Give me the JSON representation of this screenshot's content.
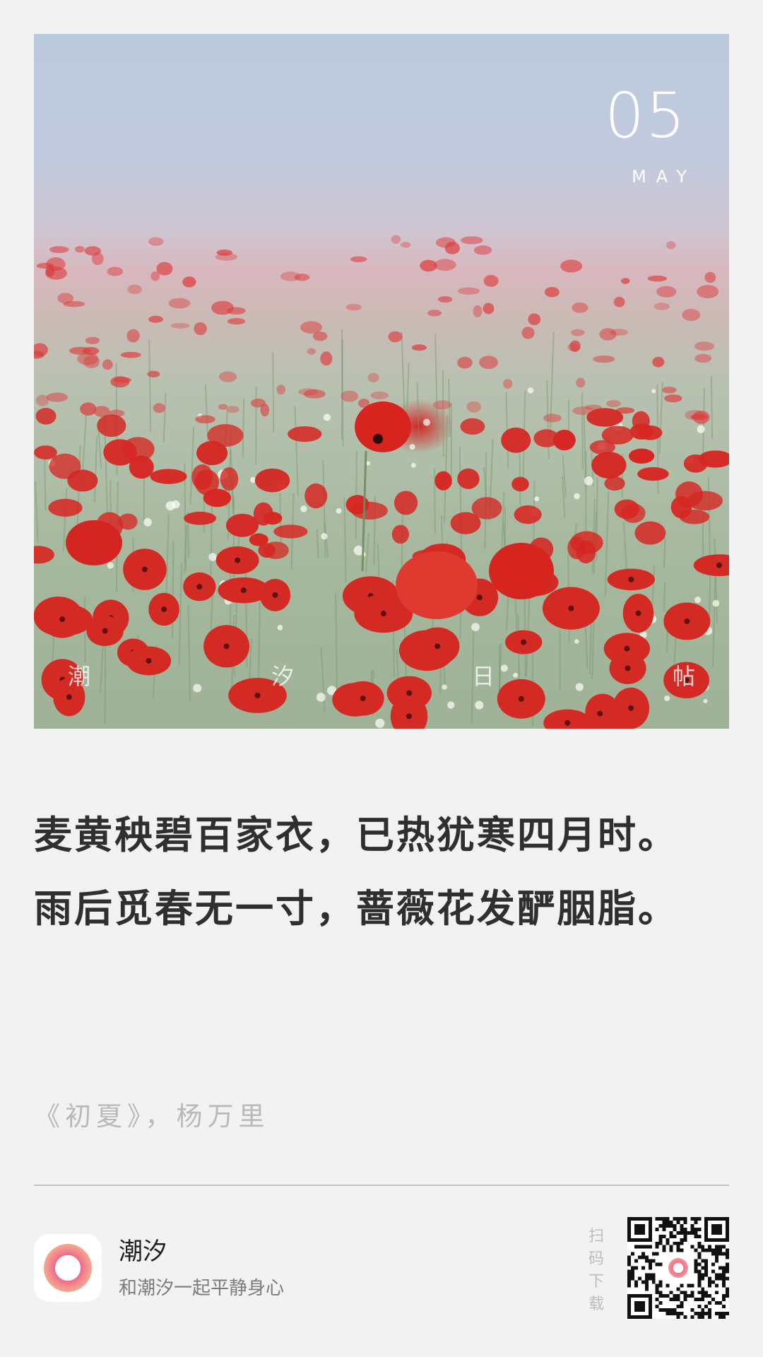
{
  "hero": {
    "date_day": "05",
    "date_month": "MAY",
    "watermark": [
      "潮",
      "汐",
      "日",
      "帖"
    ]
  },
  "poem": {
    "lines": [
      "麦黄秧碧百家衣，已热犹寒四月时。",
      "雨后觅春无一寸，蔷薇花发酽胭脂。"
    ],
    "source": "《初夏》，杨万里"
  },
  "footer": {
    "app_name": "潮汐",
    "slogan": "和潮汐一起平静身心",
    "scan_label": [
      "扫",
      "码",
      "下",
      "载"
    ]
  },
  "colors": {
    "background": "#f2f2f2",
    "poem_text": "#2f2f2f",
    "source_text": "#b9b9b9",
    "poppy_red": "#d42a24",
    "sky": "#bccadd"
  },
  "icons": {
    "app": "tide-ring-icon",
    "qr": "qr-code"
  }
}
